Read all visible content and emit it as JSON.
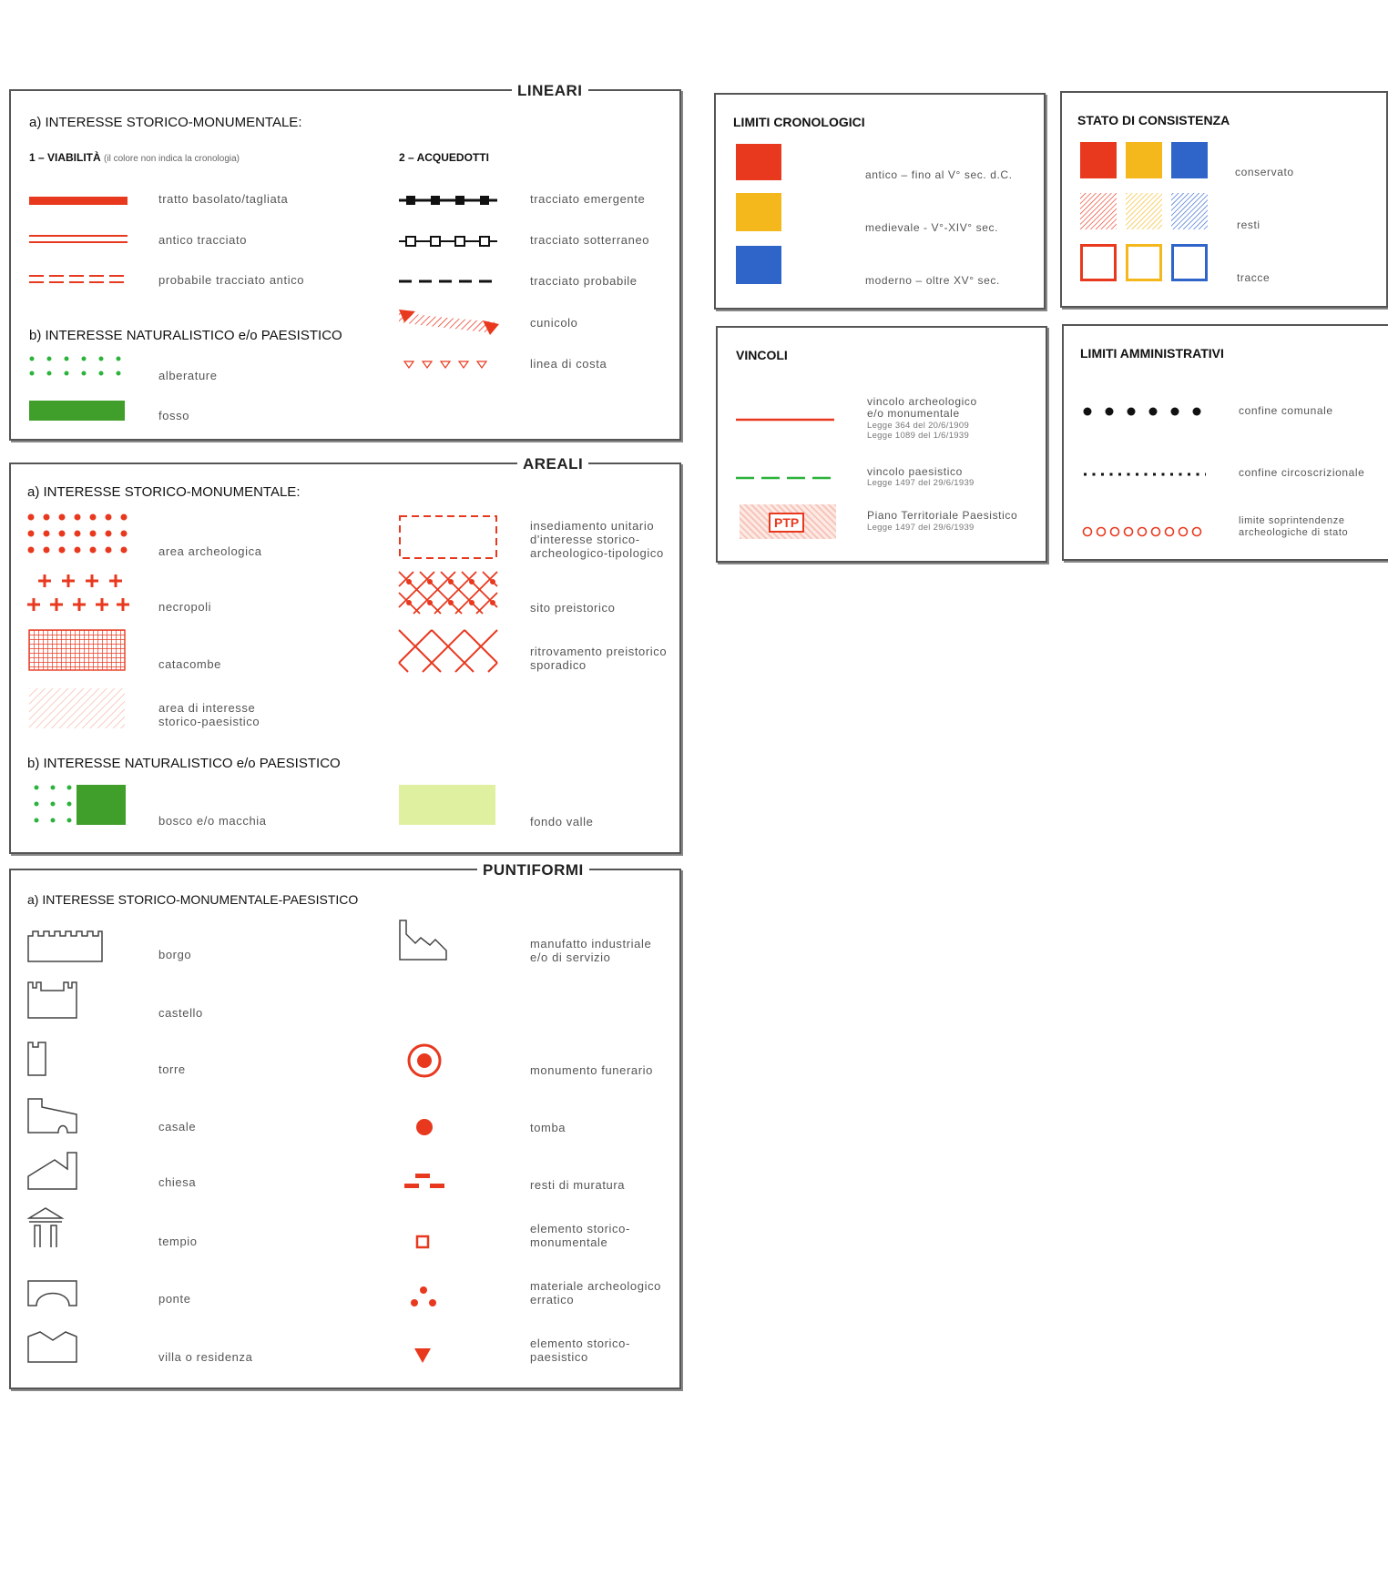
{
  "colors": {
    "red": "#e8391f",
    "yellow": "#f5b81c",
    "blue": "#2f64c9",
    "green": "#2bb33a",
    "darkgreen": "#3f9f2a",
    "lightgreen": "#dff0a0"
  },
  "lineari": {
    "title": "LINEARI",
    "section_a": "a) INTERESSE STORICO-MONUMENTALE:",
    "viabilita_title": "1 – VIABILITÀ",
    "viabilita_note": "(il colore non indica la cronologia)",
    "viabilita": [
      "tratto basolato/tagliata",
      "antico tracciato",
      "probabile tracciato antico"
    ],
    "acquedotti_title": "2 – ACQUEDOTTI",
    "acquedotti": [
      "tracciato emergente",
      "tracciato sotterraneo",
      "tracciato probabile",
      "cunicolo",
      "linea di costa"
    ],
    "section_b": "b) INTERESSE NATURALISTICO e/o PAESISTICO",
    "naturalistico": [
      "alberature",
      "fosso"
    ]
  },
  "areali": {
    "title": "AREALI",
    "section_a": "a) INTERESSE STORICO-MONUMENTALE:",
    "left": [
      "area archeologica",
      "necropoli",
      "catacombe",
      "area di interesse",
      "storico-paesistico"
    ],
    "right": [
      "insediamento unitario",
      "d'interesse storico-",
      "archeologico-tipologico",
      "sito preistorico",
      "ritrovamento preistorico",
      "sporadico"
    ],
    "section_b": "b) INTERESSE NATURALISTICO e/o PAESISTICO",
    "nat": [
      "bosco e/o macchia",
      "fondo valle"
    ]
  },
  "puntiformi": {
    "title": "PUNTIFORMI",
    "section_a": "a) INTERESSE STORICO-MONUMENTALE-PAESISTICO",
    "left": [
      "borgo",
      "castello",
      "torre",
      "casale",
      "chiesa",
      "tempio",
      "ponte",
      "villa o residenza"
    ],
    "right": [
      "manufatto industriale",
      "e/o di servizio",
      "monumento funerario",
      "tomba",
      "resti di muratura",
      "elemento storico-",
      "monumentale",
      "materiale archeologico",
      "erratico",
      "elemento storico-",
      "paesistico"
    ]
  },
  "cronologici": {
    "title": "LIMITI CRONOLOGICI",
    "items": [
      "antico – fino al V° sec. d.C.",
      "medievale - V°-XIV° sec.",
      "moderno – oltre XV° sec."
    ]
  },
  "consistenza": {
    "title": "STATO DI CONSISTENZA",
    "items": [
      "conservato",
      "resti",
      "tracce"
    ]
  },
  "vincoli": {
    "title": "VINCOLI",
    "arch": [
      "vincolo archeologico",
      "e/o monumentale"
    ],
    "arch_legge": [
      "Legge 364 del 20/6/1909",
      "Legge 1089 del 1/6/1939"
    ],
    "paes": "vincolo paesistico",
    "paes_legge": "Legge 1497 del 29/6/1939",
    "ptp_badge": "PTP",
    "ptp": "Piano Territoriale Paesistico",
    "ptp_legge": "Legge 1497 del 29/6/1939"
  },
  "amministrativi": {
    "title": "LIMITI AMMINISTRATIVI",
    "items": [
      "confine comunale",
      "confine circoscrizionale",
      "limite soprintendenze",
      "archeologiche di stato"
    ]
  }
}
